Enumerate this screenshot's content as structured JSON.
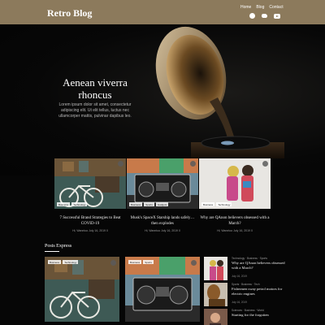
{
  "header": {
    "brand": "Retro Blog",
    "nav": [
      "Home",
      "Blog",
      "Contact"
    ],
    "social": [
      "facebook-icon",
      "twitter-icon",
      "youtube-icon"
    ],
    "colors": {
      "bar": "#8c7a5c"
    }
  },
  "hero": {
    "title": "Aenean viverra rhoncus",
    "description": "Lorem ipsum dolor sit amet, consectetur adipiscing elit. Ut elit tellus, luctus nec ullamcorper mattis, pulvinar dapibus leo."
  },
  "featured": [
    {
      "tags": [
        "Business",
        "Technology"
      ],
      "title": "7 Successful Brand Strategies to Beat COVID-19",
      "meta": "Hi, Wanntoo   July 16, 2019   0"
    },
    {
      "tags": [
        "Business",
        "Sports",
        "Gadgets"
      ],
      "title": "Musk's SpaceX Starship lands safely… then explodes",
      "meta": "Hi, Wanntoo   July 16, 2019   0"
    },
    {
      "tags": [
        "Business",
        "Technology"
      ],
      "title": "Why are QAnon believers obsessed with a March?",
      "meta": "Hi, Wanntoo   July 16, 2019   0"
    }
  ],
  "posts_express": {
    "label": "Posts Express",
    "big_cards": [
      {
        "tags": [
          "Business",
          "Technology"
        ]
      },
      {
        "tags": [
          "Business",
          "Sports"
        ]
      }
    ],
    "side_items": [
      {
        "cats": "Technology  ·  Business  ·  Sports",
        "title": "Why are QAnon believers obsessed with a March?",
        "meta": "July 16, 2019"
      },
      {
        "cats": "Sports  ·  Business  ·  Tech",
        "title": "Fishermen sway petrol motors for electric engines",
        "meta": "July 16, 2019"
      },
      {
        "cats": "Sciences  ·  Business  ·  World",
        "title": "Starting for the forgotten",
        "meta": ""
      }
    ]
  }
}
